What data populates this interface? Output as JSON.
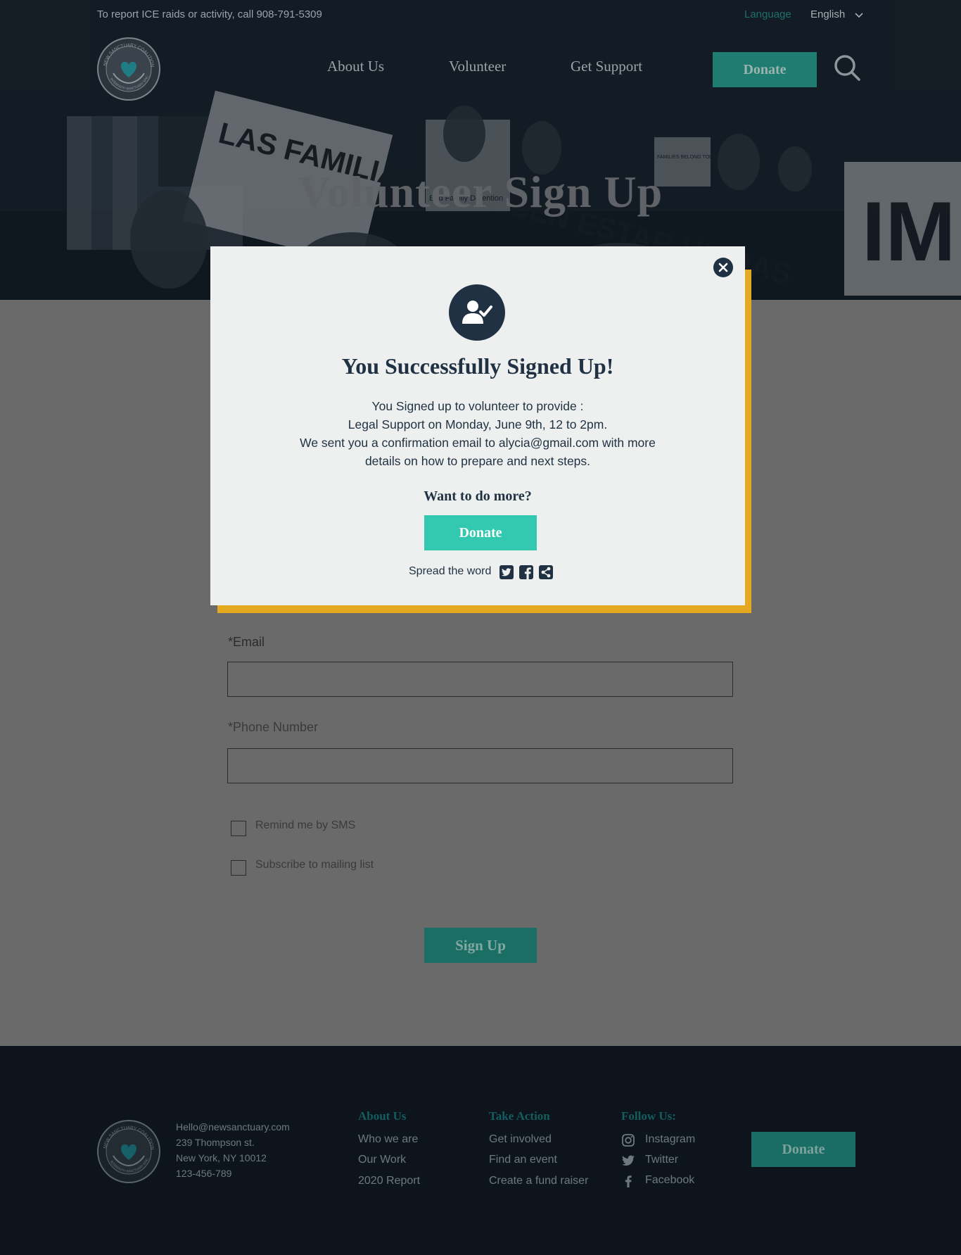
{
  "topbar": {
    "report_text": "To report ICE raids or activity, call 908-791-5309",
    "language_label": "Language",
    "language_value": "English"
  },
  "nav": {
    "items": [
      {
        "label": "About Us"
      },
      {
        "label": "Volunteer"
      },
      {
        "label": "Get Support"
      }
    ],
    "donate_label": "Donate"
  },
  "hero": {
    "title": "Volunteer Sign Up",
    "sign_texts": [
      "LAS FAMILIAS MERECEN ESTAR UNIDAS",
      "End Family Detention",
      "FAMILIES BELONG TOGETHER",
      "IM"
    ]
  },
  "logo": {
    "text_top": "NEW SANCTUARY COALITION",
    "text_bottom": "INTERFAITH SANCTUARY SINCE 2007"
  },
  "form": {
    "email_label": "*Email",
    "email_value": "",
    "phone_label": "*Phone Number",
    "phone_value": "",
    "checkboxes": [
      {
        "label": "Remind me by SMS",
        "checked": false
      },
      {
        "label": "Subscribe to mailing list",
        "checked": false
      }
    ],
    "submit_label": "Sign Up"
  },
  "modal": {
    "icon": "user-check-icon",
    "title": "You Successfully Signed Up!",
    "body_lines": [
      "You Signed up to volunteer to provide :",
      "Legal Support on Monday, June 9th, 12 to 2pm.",
      "We sent you a confirmation email to alycia@gmail.com with more",
      "details on how to prepare and next steps."
    ],
    "more_heading": "Want to do more?",
    "donate_label": "Donate",
    "spread_label": "Spread the word",
    "share_icons": [
      "twitter-icon",
      "facebook-icon",
      "share-icon"
    ]
  },
  "footer": {
    "contact": {
      "email": "Hello@newsanctuary.com",
      "street": "239 Thompson st.",
      "city": "New York, NY 10012",
      "phone": "123-456-789"
    },
    "columns": [
      {
        "heading": "About Us",
        "links": [
          "Who we are",
          "Our Work",
          "2020 Report"
        ]
      },
      {
        "heading": "Take Action",
        "links": [
          "Get involved",
          "Find an event",
          "Create a fund raiser"
        ]
      },
      {
        "heading": "Follow Us:",
        "links": [
          "Instagram",
          "Twitter",
          "Facebook"
        ]
      }
    ],
    "donate_label": "Donate"
  },
  "colors": {
    "accent_teal": "#33c9b0",
    "dimmed_teal": "#1f7c70",
    "navy": "#1f3142",
    "modal_shadow": "#e4a821",
    "overlay_gray": "#6a6a6a",
    "footer_bg": "#0d141c"
  }
}
